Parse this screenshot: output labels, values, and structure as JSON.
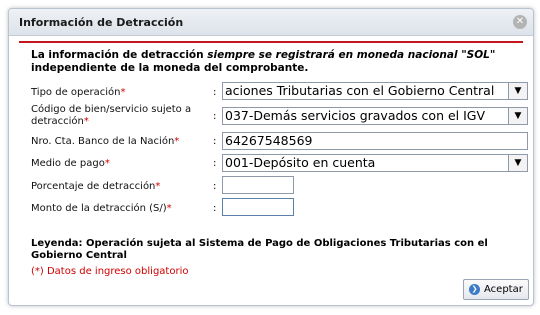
{
  "dialog": {
    "title": "Información de Detracción",
    "intro_part1": "La información de detracción ",
    "intro_italic": "siempre se registrará en moneda nacional \"SOL\"",
    "intro_part2": " independiente de la moneda del comprobante."
  },
  "form": {
    "tipo_operacion": {
      "label": "Tipo de operación",
      "value": "aciones Tributarias con el Gobierno Central"
    },
    "codigo_bien": {
      "label_line1": "Código de bien/servicio sujeto a",
      "label_line2": "detracción",
      "value": "037-Demás servicios gravados con el IGV"
    },
    "nro_cta": {
      "label": "Nro. Cta. Banco de la Nación",
      "value": "64267548569"
    },
    "medio_pago": {
      "label": "Medio de pago",
      "value": "001-Depósito en cuenta"
    },
    "porcentaje": {
      "label": "Porcentaje de detracción",
      "value": ""
    },
    "monto": {
      "label": "Monto de la detracción (S/)",
      "value": ""
    },
    "required_mark": "*",
    "colon": ":"
  },
  "legend": "Leyenda: Operación sujeta al Sistema de Pago de Obligaciones Tributarias con el Gobierno Central",
  "required_note": "(*) Datos de ingreso obligatorio",
  "buttons": {
    "accept": "Aceptar"
  },
  "icons": {
    "close": "close-icon",
    "select_arrow": "chevron-down-icon",
    "accept": "check-circle-icon"
  },
  "colors": {
    "accent_red": "#c4161c",
    "required": "#d00000",
    "accept_icon": "#3b7bc8"
  }
}
